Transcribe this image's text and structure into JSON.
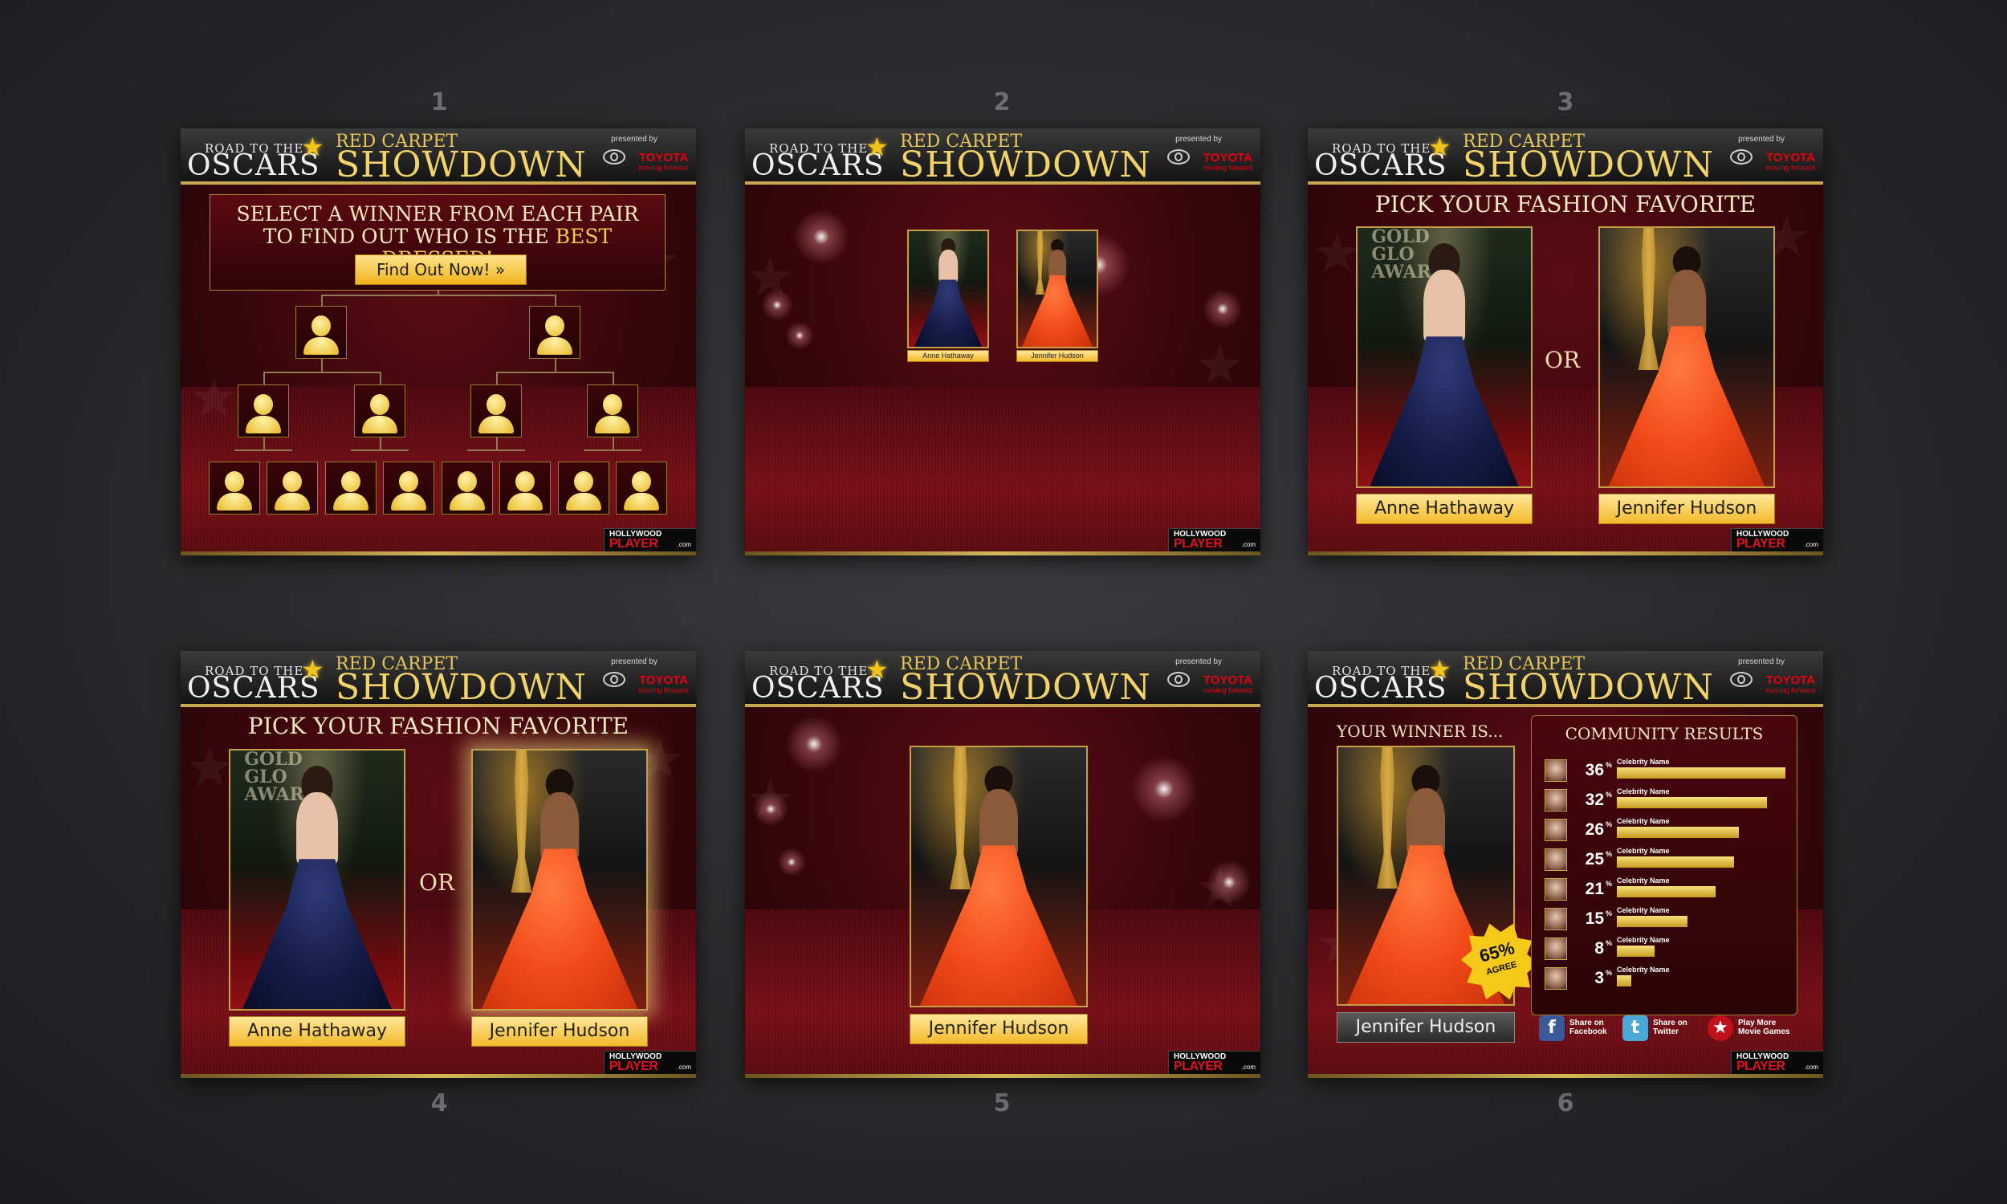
{
  "steps": [
    "1",
    "2",
    "3",
    "4",
    "5",
    "6"
  ],
  "header": {
    "road_to_the": "ROAD TO THE",
    "oscars": "OSCARS",
    "red_carpet": "RED CARPET",
    "showdown": "SHOWDOWN",
    "presented_by": "presented by",
    "sponsor": "TOYOTA",
    "sponsor_tagline": "moving forward"
  },
  "badge": {
    "hollywood": "HOLLYWOOD",
    "player": "PLAYER",
    "com": ".com"
  },
  "panel1": {
    "line1": "SELECT A WINNER FROM EACH PAIR",
    "line2_prefix": "TO FIND OUT WHO IS THE",
    "line2_emph": "BEST DRESSED!",
    "cta": "Find Out Now! »"
  },
  "contestants": {
    "a": "Anne Hathaway",
    "b": "Jennifer Hudson"
  },
  "pick_title": "PICK YOUR FASHION FAVORITE",
  "or": "OR",
  "panel6": {
    "winner_title": "YOUR WINNER IS...",
    "winner": "Jennifer Hudson",
    "results_title": "COMMUNITY RESULTS",
    "agree_pct": "65%",
    "agree_label": "AGREE",
    "results": [
      {
        "pct": "36",
        "name": "Celebrity Name",
        "value": 36
      },
      {
        "pct": "32",
        "name": "Celebrity Name",
        "value": 32
      },
      {
        "pct": "26",
        "name": "Celebrity Name",
        "value": 26
      },
      {
        "pct": "25",
        "name": "Celebrity Name",
        "value": 25
      },
      {
        "pct": "21",
        "name": "Celebrity Name",
        "value": 21
      },
      {
        "pct": "15",
        "name": "Celebrity Name",
        "value": 15
      },
      {
        "pct": "8",
        "name": "Celebrity Name",
        "value": 8
      },
      {
        "pct": "3",
        "name": "Celebrity Name",
        "value": 3
      }
    ],
    "pct_sign": "%",
    "share_facebook": "Share on Facebook",
    "share_twitter": "Share on Twitter",
    "play_more": "Play More Movie Games"
  },
  "colors": {
    "gold": "#f1d36a",
    "carpet": "#7a0f17",
    "toyota_red": "#e3000f"
  }
}
